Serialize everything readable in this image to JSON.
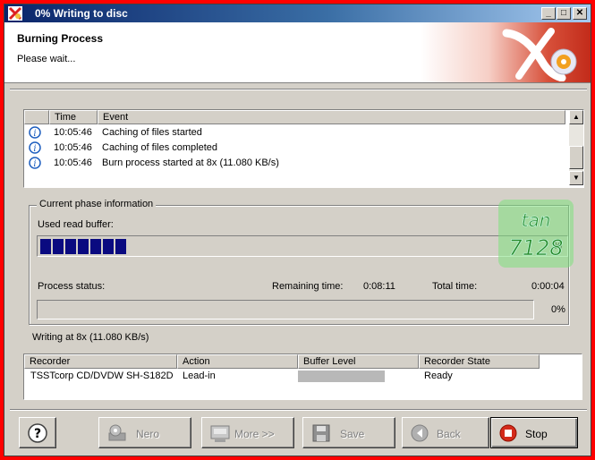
{
  "window": {
    "title": "0% Writing to disc",
    "controls": {
      "minimize": "_",
      "maximize": "□",
      "close": "✕"
    }
  },
  "header": {
    "title": "Burning Process",
    "subtitle": "Please wait..."
  },
  "log": {
    "columns": [
      "Time",
      "Event"
    ],
    "rows": [
      {
        "icon": "info-icon",
        "time": "10:05:46",
        "event": "Caching of files started"
      },
      {
        "icon": "info-icon",
        "time": "10:05:46",
        "event": "Caching of files completed"
      },
      {
        "icon": "info-icon",
        "time": "10:05:46",
        "event": "Burn process started at 8x (11.080 KB/s)"
      }
    ]
  },
  "phase": {
    "group_label": "Current phase information",
    "buffer_label": "Used read buffer:",
    "buffer_percent_text": "%",
    "buffer_fill_blocks": 7,
    "process_status_label": "Process status:",
    "remaining_label": "Remaining time:",
    "remaining_value": "0:08:11",
    "total_label": "Total time:",
    "total_value": "0:00:04",
    "progress_text": "0%",
    "progress_value": 0
  },
  "watermark": {
    "line1": "tan",
    "line2": "7128"
  },
  "writing_status": "Writing at 8x (11.080 KB/s)",
  "recorders": {
    "columns": [
      "Recorder",
      "Action",
      "Buffer Level",
      "Recorder State"
    ],
    "rows": [
      {
        "recorder": "TSSTcorp CD/DVDW SH-S182D",
        "action": "Lead-in",
        "buffer_level": 0,
        "state": "Ready"
      }
    ]
  },
  "buttons": {
    "help": "?",
    "nero": "Nero",
    "more": "More >>",
    "save": "Save",
    "back": "Back",
    "stop": "Stop"
  },
  "colors": {
    "buffer_fill": "#0a0a80",
    "title_bar": "#0a246a",
    "frame": "#ff0000"
  }
}
